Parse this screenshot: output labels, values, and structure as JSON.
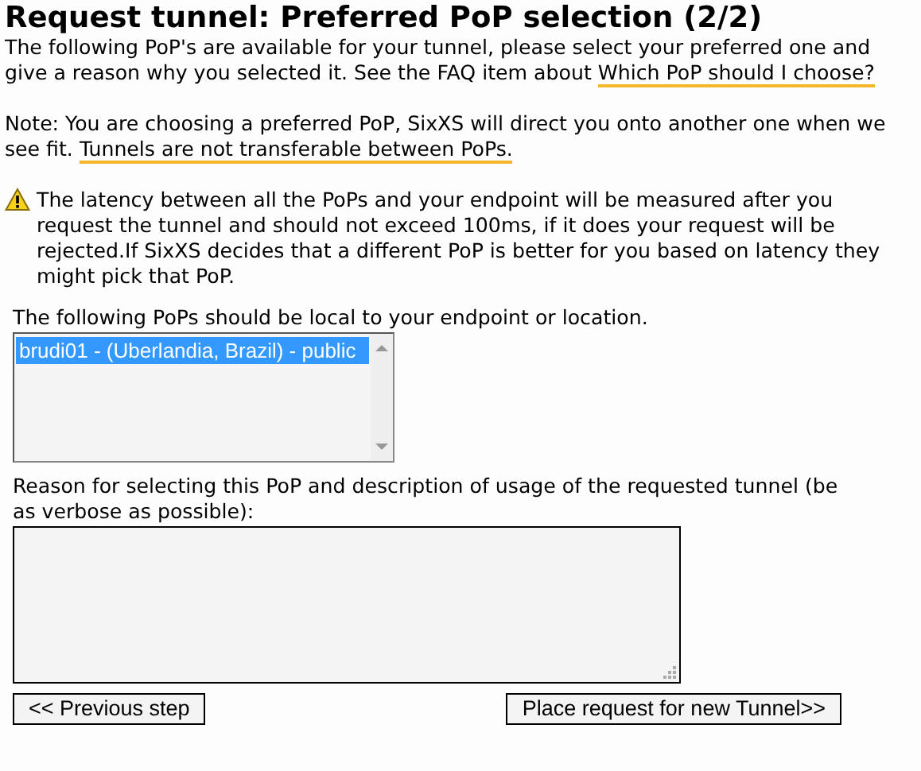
{
  "title": "Request tunnel: Preferred PoP selection (2/2)",
  "intro": {
    "text": "The following PoP's are available for your tunnel, please select your preferred one and give a reason why you selected it. See the FAQ item about ",
    "link": "Which PoP should I choose?"
  },
  "note": {
    "text": "Note: You are choosing a preferred PoP, SixXS will direct you onto another one when we see fit. ",
    "link": "Tunnels are not transferable between PoPs."
  },
  "warning": "The latency between all the PoPs and your endpoint will be measured after you request the tunnel and should not exceed 100ms, if it does your request will be rejected.If SixXS decides that a different PoP is better for you based on latency they might pick that PoP.",
  "pop_list": {
    "label": "The following PoPs should be local to your endpoint or location.",
    "options": [
      {
        "label": "brudi01 - (Uberlandia, Brazil) - public",
        "selected": true
      }
    ]
  },
  "reason": {
    "label": "Reason for selecting this PoP and description of usage of the requested tunnel (be as verbose as possible):"
  },
  "buttons": [
    "<< Previous step",
    "Place request for new Tunnel>>"
  ]
}
